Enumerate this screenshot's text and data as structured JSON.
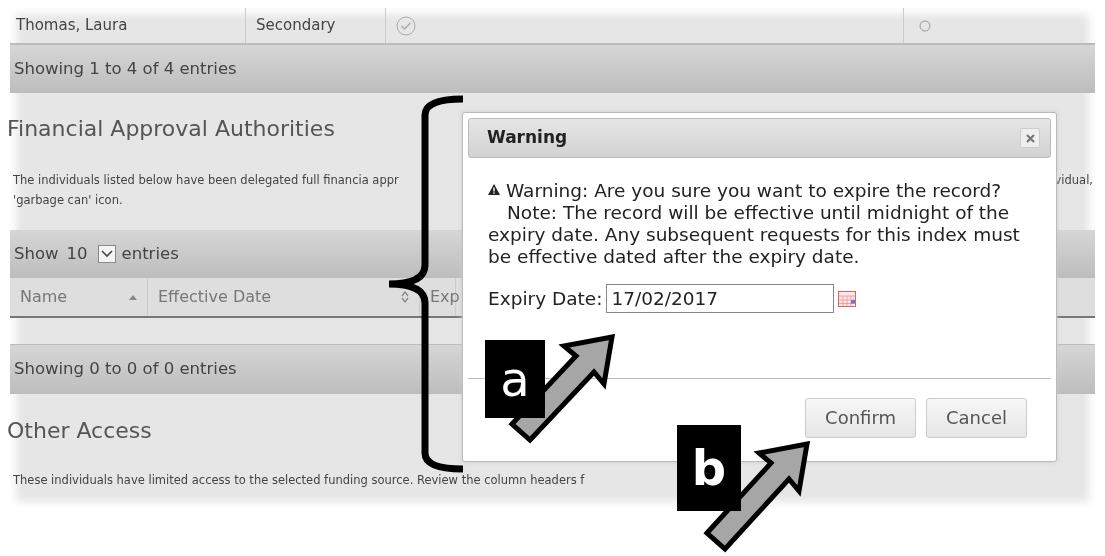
{
  "top_table": {
    "row": {
      "name": "Thomas, Laura",
      "role": "Secondary",
      "checked": true,
      "radio_selected": false
    },
    "footer": "Showing 1 to 4 of 4 entries"
  },
  "financial_section": {
    "heading": "Financial Approval Authorities",
    "description_line_1": "The individuals listed below have been delegated full financia appr",
    "description_line_1_end": "vidual,",
    "description_line_2": "'garbage can' icon.",
    "length_menu": {
      "before": "Show",
      "value": "10",
      "after": "entries"
    },
    "columns": [
      {
        "label": "Name",
        "sorted": true
      },
      {
        "label": "Effective Date",
        "sorted": false
      },
      {
        "label": "Exp"
      }
    ],
    "footer": "Showing 0 to 0 of 0 entries"
  },
  "other_section": {
    "heading": "Other Access",
    "description": "These individuals have limited access to the selected funding source. Review the column headers f"
  },
  "dialog": {
    "title": "Warning",
    "message_line_1": "Warning: Are you sure you want to expire the record?",
    "message_rest": "Note: The record will be effective until midnight of the expiry date. Any subsequent requests for this index must be effective dated after the expiry date.",
    "field_label": "Expiry Date:",
    "field_value": "17/02/2017",
    "buttons": [
      "Confirm",
      "Cancel"
    ]
  },
  "annotations": [
    {
      "label": "a"
    },
    {
      "label": "b"
    }
  ]
}
